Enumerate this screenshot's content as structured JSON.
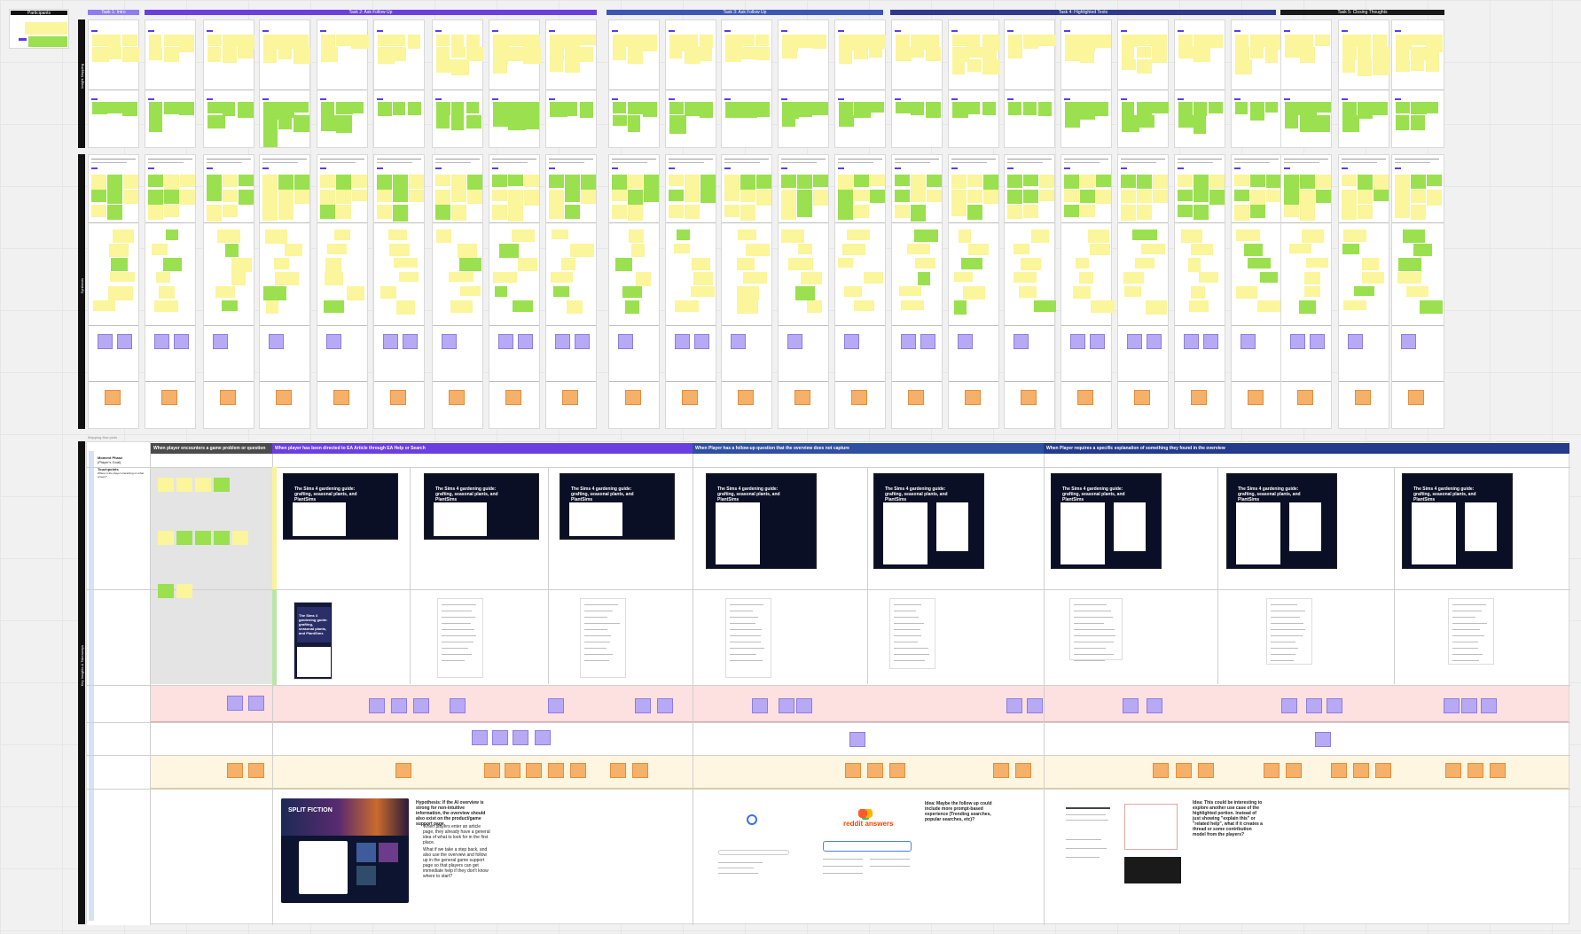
{
  "participants": {
    "label": "Participants"
  },
  "sections": {
    "affinity": "Insight Mapping",
    "synthesis": "Synthesis",
    "key_insights": "Key Insights & Takeaways"
  },
  "task_headers": [
    {
      "label": "Task 1: Intro",
      "color": "#8e7cf0"
    },
    {
      "label": "Task 2: Ask Follow Up",
      "color": "#6a3fe0"
    },
    {
      "label": "Task 3: Ask Follow Up",
      "color": "#3d57b8"
    },
    {
      "label": "Task 4: Highlighted Texts",
      "color": "#2f3a8f"
    },
    {
      "label": "Task 5: Closing Thoughts",
      "color": "#1a1a1a"
    }
  ],
  "mapping_caption": "Mapping flow plots",
  "journey_headers": [
    {
      "label": "When player encounters a game problem or question",
      "color": "#4b4b4b"
    },
    {
      "label": "When player has been directed to EA Article through EA Help or Search",
      "color": "#6a3fe0"
    },
    {
      "label": "When Player has a follow-up question that the overview does not capture",
      "color": "#2f4fa0"
    },
    {
      "label": "When Player requires a specific explanation of something they found in the overview",
      "color": "#243a8a"
    }
  ],
  "row_labels": {
    "moment": "Moment Phase",
    "moment_sub": "(Player's Goal)",
    "touchpoints": "Touchpoints",
    "touchpoints_sub": "Where is the player interacting on what screen?"
  },
  "article": {
    "title": "The Sims 4 gardening guide: grafting, seasonal plants, and PlantSims"
  },
  "mobile_article": {
    "title": "The Sims 4 gardening guide: grafting, seasonal plants, and PlantSims"
  },
  "hypothesis": {
    "lead": "Hypothesis: If the AI overview is strong for non-intuitive information, the overview should also exist on the product/game support page.",
    "b1": "When players enter an article page, they already have a general idea of what to look for in the first place.",
    "b2": "What if we take a step back, and also use the overview and follow up in the general game support page so that players can get immediate help if they don't know where to start?"
  },
  "idea1": "Idea: Maybe the follow up could include more prompt-based experience (Trending searches, popular searches, etc)?",
  "idea2": "Idea: This could be interesting to explore another use case of the highlighted portion. Instead of just showing \"explain this\" or \"related help\", what if it creates a thread or some contribution model from the players?",
  "reddit": {
    "name": "reddit answers"
  },
  "game_card": {
    "title": "SPLIT FICTION"
  },
  "sticky_notes": {
    "n1": "Keep the guide or in the bottom",
    "n2": "Need more context to play",
    "n3": "Separate tracks for the feature",
    "n4": "Add details into the overview",
    "n5": "Change highlight",
    "n6": "Change highlight",
    "n7": "Want easy access to the main",
    "n8": "Suggest the guide for the feature",
    "n9": "Cut and paste into the overview",
    "n10": "Contextual overview requirement",
    "n11": "Make notes on Ask button",
    "n12": "Want to go to the guide"
  }
}
